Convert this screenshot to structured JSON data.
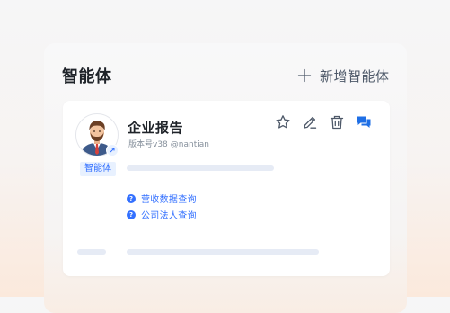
{
  "panel": {
    "title": "智能体",
    "add_button_label": "新增智能体"
  },
  "agent": {
    "name": "企业报告",
    "version": "版本号v38",
    "author": "@nantian",
    "type_tag": "智能体",
    "suggested_questions": [
      "营收数据查询",
      "公司法人查询"
    ]
  },
  "actions": [
    {
      "name": "favorite",
      "icon": "star-icon"
    },
    {
      "name": "edit",
      "icon": "pencil-icon"
    },
    {
      "name": "delete",
      "icon": "trash-icon"
    },
    {
      "name": "chat",
      "icon": "chat-bubbles-icon"
    }
  ],
  "colors": {
    "accent": "#3370ff",
    "title_text": "#1f2329",
    "secondary_text": "#86909c",
    "icon_gray": "#4e5969",
    "skeleton": "#e6ebf5",
    "tag_bg": "#e8f1ff"
  }
}
